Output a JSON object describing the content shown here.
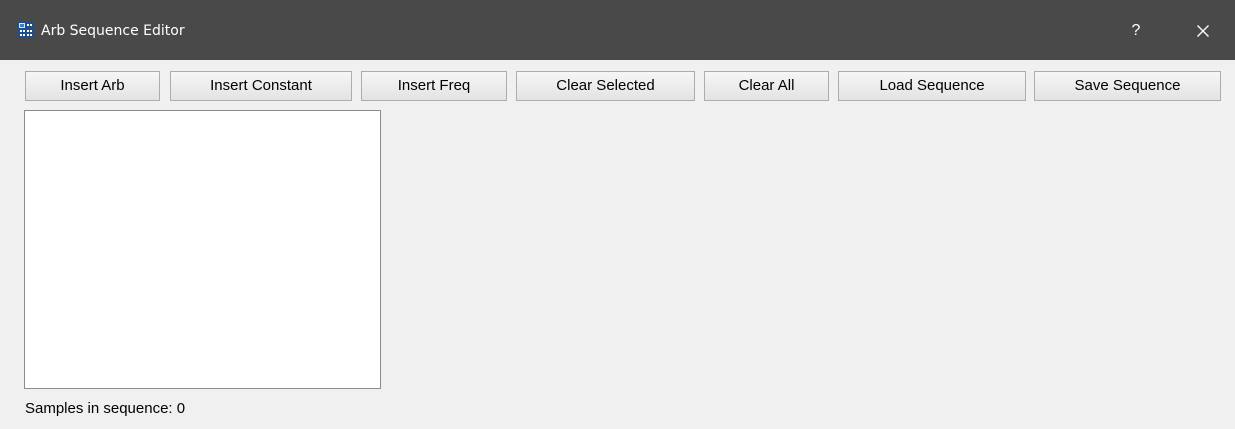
{
  "window": {
    "title": "Arb Sequence Editor",
    "app_icon": "grid-app-icon",
    "help_label": "?",
    "close_icon": "close-icon",
    "titlebar_color": "#494949"
  },
  "toolbar": {
    "insert_arb": "Insert Arb",
    "insert_constant": "Insert Constant",
    "insert_freq": "Insert Freq",
    "clear_selected": "Clear Selected",
    "clear_all": "Clear All",
    "load_sequence": "Load Sequence",
    "save_sequence": "Save Sequence"
  },
  "sequence_list": {
    "items": []
  },
  "status": {
    "samples_label": "Samples in sequence: 0"
  }
}
